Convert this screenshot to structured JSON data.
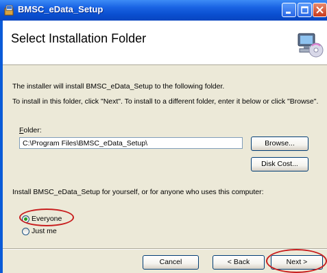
{
  "window": {
    "title": "BMSC_eData_Setup",
    "title_icon": "installer-icon",
    "controls": [
      "minimize-icon",
      "maximize-icon",
      "close-icon"
    ]
  },
  "header": {
    "title": "Select Installation Folder",
    "icon": "computer-disc-icon"
  },
  "body": {
    "intro_line1": "The installer will install BMSC_eData_Setup to the following folder.",
    "intro_line2": "To install in this folder, click \"Next\". To install to a different folder, enter it below or click \"Browse\".",
    "folder_label": "Folder:",
    "folder_value": "C:\\Program Files\\BMSC_eData_Setup\\",
    "browse_label": "Browse...",
    "disk_cost_label": "Disk Cost...",
    "install_for_label": "Install BMSC_eData_Setup for yourself, or for anyone who uses this computer:",
    "options": [
      {
        "label": "Everyone",
        "selected": true
      },
      {
        "label": "Just me",
        "selected": false
      }
    ]
  },
  "footer": {
    "cancel_label": "Cancel",
    "back_label": "< Back",
    "next_label": "Next >"
  },
  "colors": {
    "titlebar": "#0a4fd0",
    "dialog_bg": "#ece9d8",
    "annotation": "#c81e1e"
  }
}
